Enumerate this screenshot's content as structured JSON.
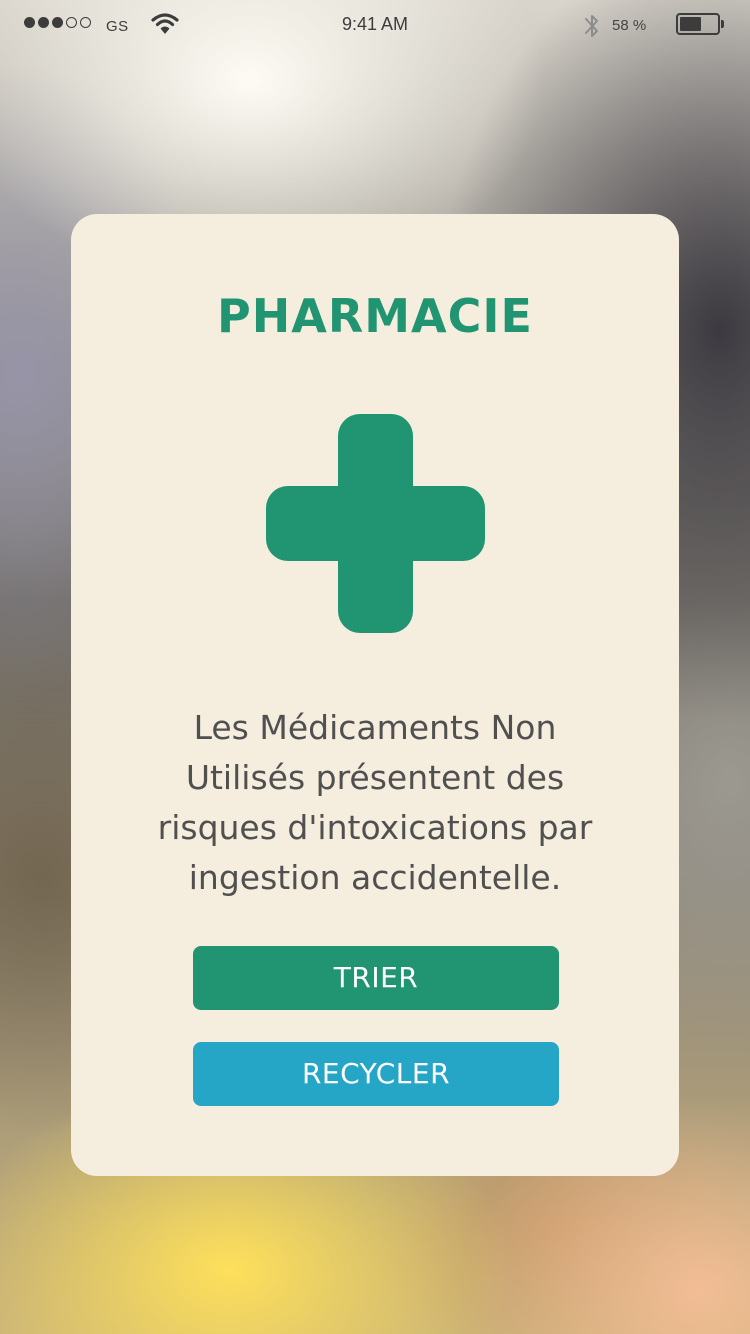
{
  "status_bar": {
    "signal_bars_filled": 3,
    "signal_bars_total": 5,
    "carrier": "GS",
    "time": "9:41 AM",
    "battery_percent_label": "58 %",
    "battery_level": 0.58,
    "icons": [
      "signal-dots-icon",
      "wifi-icon",
      "bluetooth-icon",
      "battery-icon"
    ]
  },
  "card": {
    "title": "PHARMACIE",
    "icon": "medical-cross-icon",
    "message_lines": [
      "Les Médicaments Non",
      "Utilisés présentent des",
      "risques d'intoxications par",
      "ingestion accidentelle."
    ],
    "buttons": {
      "sort_label": "TRIER",
      "recycle_label": "RECYCLER"
    }
  },
  "colors": {
    "accent_green": "#219472",
    "accent_blue": "#25a6c6",
    "card_background": "#f5eedf",
    "text_dark": "#505050"
  }
}
